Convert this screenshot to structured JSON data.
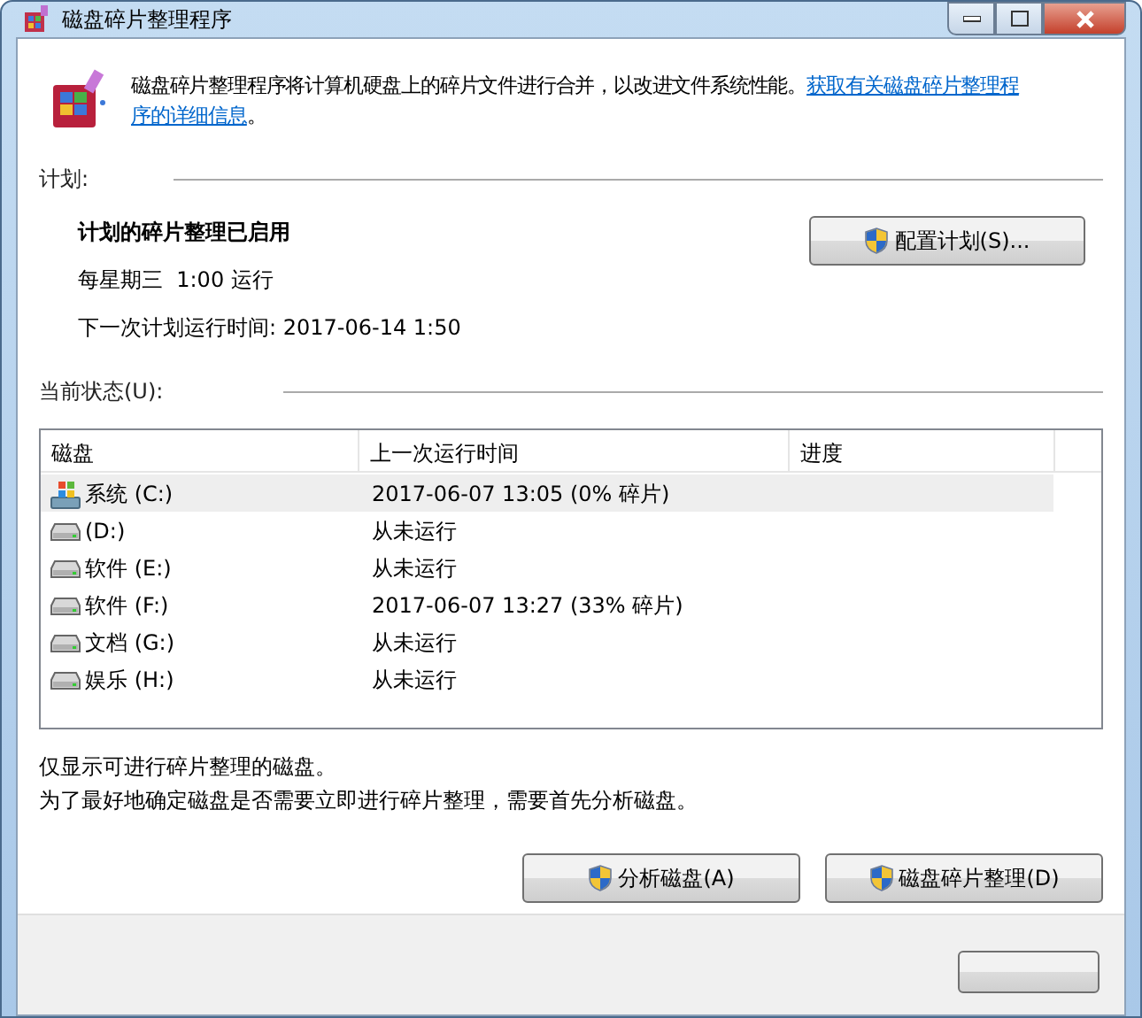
{
  "window": {
    "title": "磁盘碎片整理程序"
  },
  "intro": {
    "text": "磁盘碎片整理程序将计算机硬盘上的碎片文件进行合并，以改进文件系统性能。",
    "link_lines": [
      "获取有关磁盘碎片整理程",
      "序的详细信息"
    ],
    "suffix": "。"
  },
  "schedule": {
    "heading": "计划:",
    "status": "计划的碎片整理已启用",
    "frequency": "每星期三  1:00 运行",
    "next_run": "下一次计划运行时间: 2017-06-14 1:50",
    "button": "配置计划(S)..."
  },
  "current_status": {
    "heading": "当前状态(U):",
    "columns": [
      "磁盘",
      "上一次运行时间",
      "进度"
    ],
    "rows": [
      {
        "kind": "system",
        "disk": "系统 (C:)",
        "last_run": "2017-06-07 13:05 (0% 碎片)",
        "selected": true
      },
      {
        "kind": "drive",
        "disk": "(D:)",
        "last_run": "从未运行",
        "selected": false
      },
      {
        "kind": "drive",
        "disk": "软件 (E:)",
        "last_run": "从未运行",
        "selected": false
      },
      {
        "kind": "drive",
        "disk": "软件 (F:)",
        "last_run": "2017-06-07 13:27 (33% 碎片)",
        "selected": false
      },
      {
        "kind": "drive",
        "disk": "文档 (G:)",
        "last_run": "从未运行",
        "selected": false
      },
      {
        "kind": "drive",
        "disk": "娱乐 (H:)",
        "last_run": "从未运行",
        "selected": false
      }
    ]
  },
  "notes": [
    "仅显示可进行碎片整理的磁盘。",
    "为了最好地确定磁盘是否需要立即进行碎片整理，需要首先分析磁盘。"
  ],
  "buttons": [
    "分析磁盘(A)",
    "磁盘碎片整理(D)"
  ]
}
